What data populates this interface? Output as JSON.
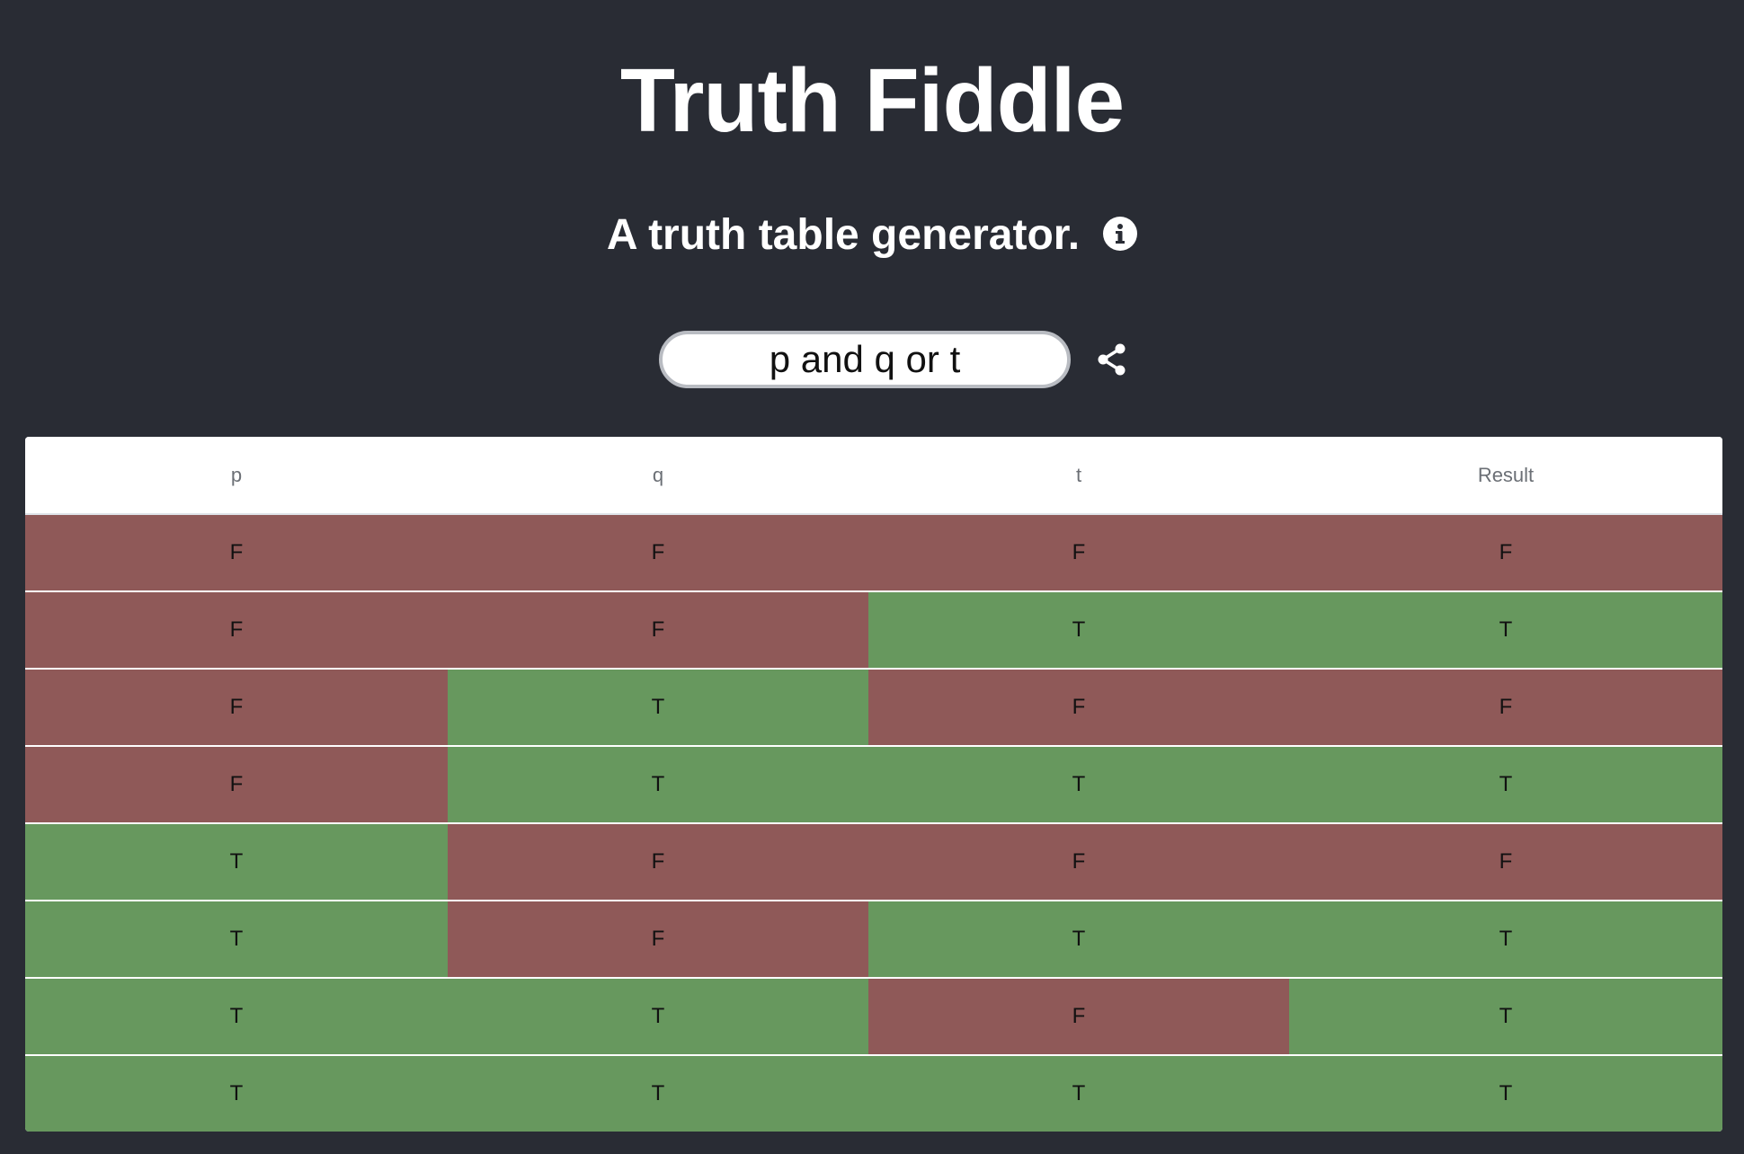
{
  "app": {
    "title": "Truth Fiddle",
    "subtitle": "A truth table generator."
  },
  "expression": {
    "value": "p and q or t"
  },
  "icons": {
    "info": "info-icon",
    "share": "share-icon"
  },
  "colors": {
    "background": "#292c34",
    "true_cell": "#67985e",
    "false_cell": "#8f5958"
  },
  "table": {
    "headers": [
      "p",
      "q",
      "t",
      "Result"
    ],
    "rows": [
      [
        "F",
        "F",
        "F",
        "F"
      ],
      [
        "F",
        "F",
        "T",
        "T"
      ],
      [
        "F",
        "T",
        "F",
        "F"
      ],
      [
        "F",
        "T",
        "T",
        "T"
      ],
      [
        "T",
        "F",
        "F",
        "F"
      ],
      [
        "T",
        "F",
        "T",
        "T"
      ],
      [
        "T",
        "T",
        "F",
        "T"
      ],
      [
        "T",
        "T",
        "T",
        "T"
      ]
    ]
  }
}
